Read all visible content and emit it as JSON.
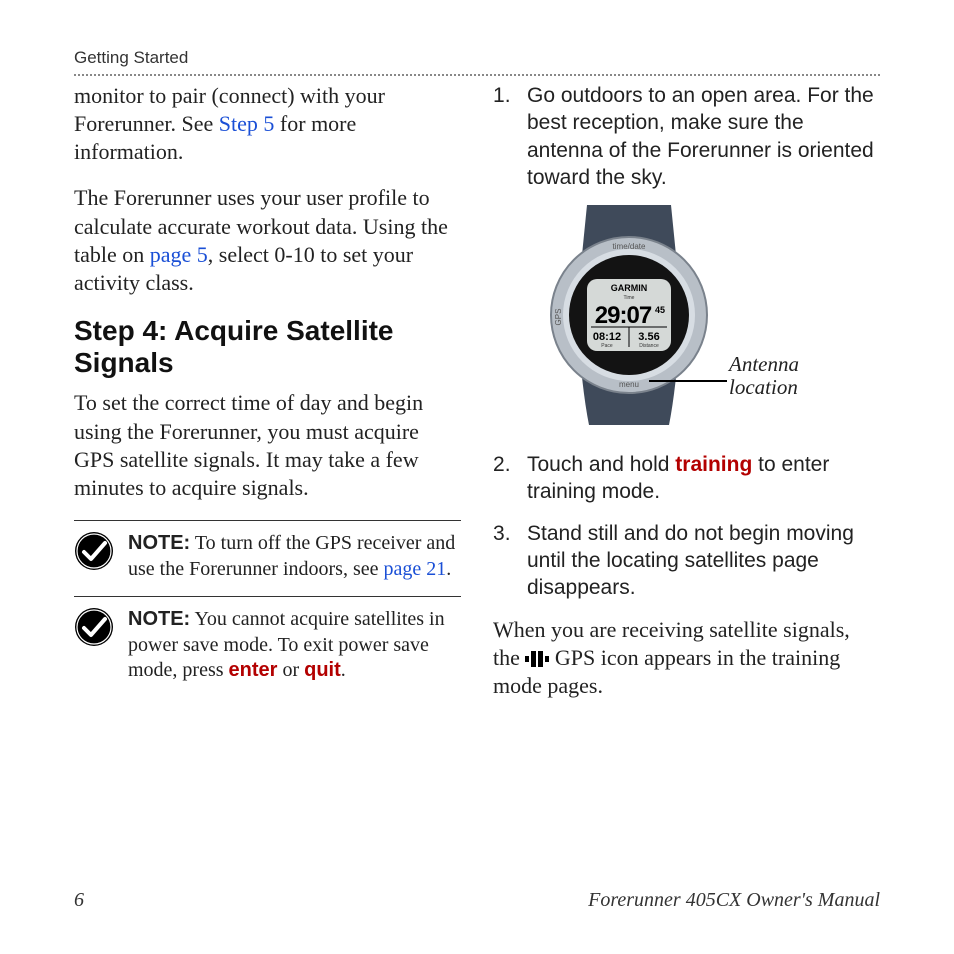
{
  "header": {
    "section": "Getting Started"
  },
  "left": {
    "intro1a": "monitor to pair (connect) with your Forerunner. See ",
    "intro1_link": "Step 5",
    "intro1b": " for more information.",
    "intro2a": "The Forerunner uses your user profile to calculate accurate workout data. Using the table on ",
    "intro2_link": "page 5",
    "intro2b": ", select 0-10 to set your activity class.",
    "heading": "Step 4: Acquire Satellite Signals",
    "step4_body": "To set the correct time of day and begin using the Forerunner, you must acquire GPS satellite signals. It may take a few minutes to acquire signals.",
    "note1_label": "NOTE:",
    "note1a": " To turn off the GPS receiver and use the Forerunner indoors, see ",
    "note1_link": "page 21",
    "note1b": ".",
    "note2_label": "NOTE:",
    "note2a": " You cannot acquire satellites in power save mode. To exit power save mode, press ",
    "note2_enter": "enter",
    "note2_or": " or ",
    "note2_quit": "quit",
    "note2b": "."
  },
  "right": {
    "step1": "Go outdoors to an open area. For the best reception, make sure the antenna of the Forerunner is oriented toward the sky.",
    "antenna_label_1": "Antenna",
    "antenna_label_2": "location",
    "step2a": "Touch and hold ",
    "step2_training": "training",
    "step2b": " to enter training mode.",
    "step3": "Stand still and do not begin moving until the locating satellites page disappears.",
    "closing_a": "When you are receiving satellite signals, the ",
    "closing_b": " GPS icon appears in the training mode pages."
  },
  "watch": {
    "brand": "GARMIN",
    "time_label": "Time",
    "time_main": "29:07",
    "time_sec": "45",
    "bottom_left": "08:12",
    "bottom_left_label": "Pace",
    "bottom_right": "3.56",
    "bottom_right_label": "Distance",
    "bezel_top": "time/date",
    "bezel_left": "GPS",
    "bezel_bottom": "menu"
  },
  "footer": {
    "page": "6",
    "title": "Forerunner 405CX Owner's Manual"
  }
}
